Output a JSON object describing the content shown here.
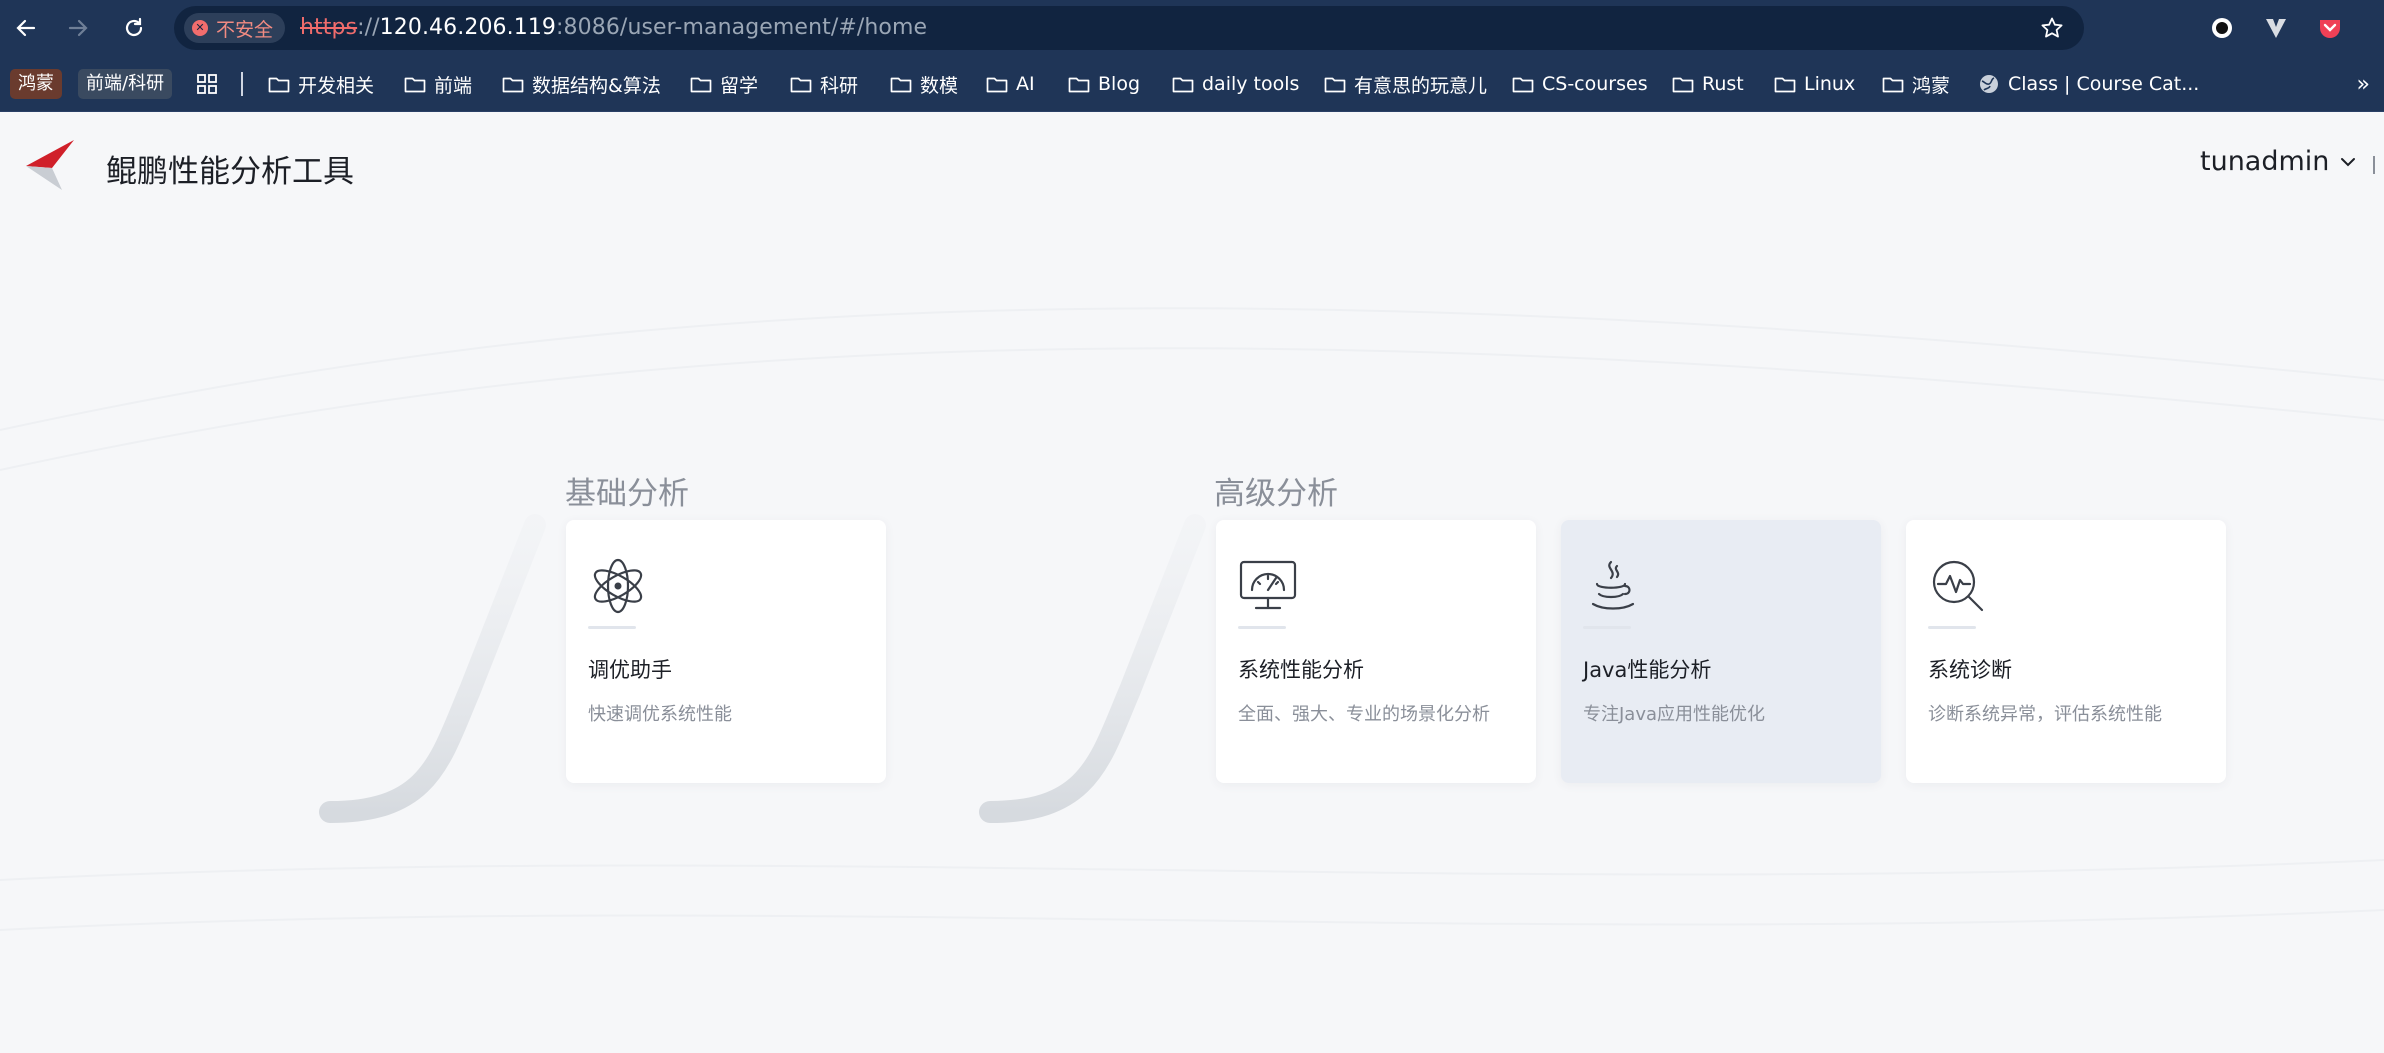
{
  "browser": {
    "security_chip": "不安全",
    "url": {
      "scheme": "https",
      "separator": "://",
      "host": "120.46.206.119",
      "rest": ":8086/user-management/#/home"
    },
    "bookmarks": {
      "tag_1": "鸿蒙",
      "tag_2": "前端/科研",
      "folders": [
        "开发相关",
        "前端",
        "数据结构&算法",
        "留学",
        "科研",
        "数模",
        "AI",
        "Blog",
        "daily tools",
        "有意思的玩意儿",
        "CS-courses",
        "Rust",
        "Linux",
        "鸿蒙"
      ],
      "last_link": "Class | Course Cat..."
    },
    "overflow": "»"
  },
  "app": {
    "title": "鲲鹏性能分析工具",
    "user": "tunadmin"
  },
  "sections": {
    "basic": {
      "title": "基础分析",
      "cards": [
        {
          "title": "调优助手",
          "desc": "快速调优系统性能",
          "icon": "atom-icon"
        }
      ]
    },
    "advanced": {
      "title": "高级分析",
      "cards": [
        {
          "title": "系统性能分析",
          "desc": "全面、强大、专业的场景化分析",
          "icon": "monitor-gauge-icon"
        },
        {
          "title": "Java性能分析",
          "desc": "专注Java应用性能优化",
          "icon": "java-cup-icon"
        },
        {
          "title": "系统诊断",
          "desc": "诊断系统异常，评估系统性能",
          "icon": "diagnosis-search-icon"
        }
      ]
    }
  },
  "colors": {
    "chrome": "#1f3557",
    "omnibox": "#112440",
    "page_bg": "#f6f7f9",
    "brand_red": "#d0202a",
    "active_card": "#e8ecf3"
  }
}
